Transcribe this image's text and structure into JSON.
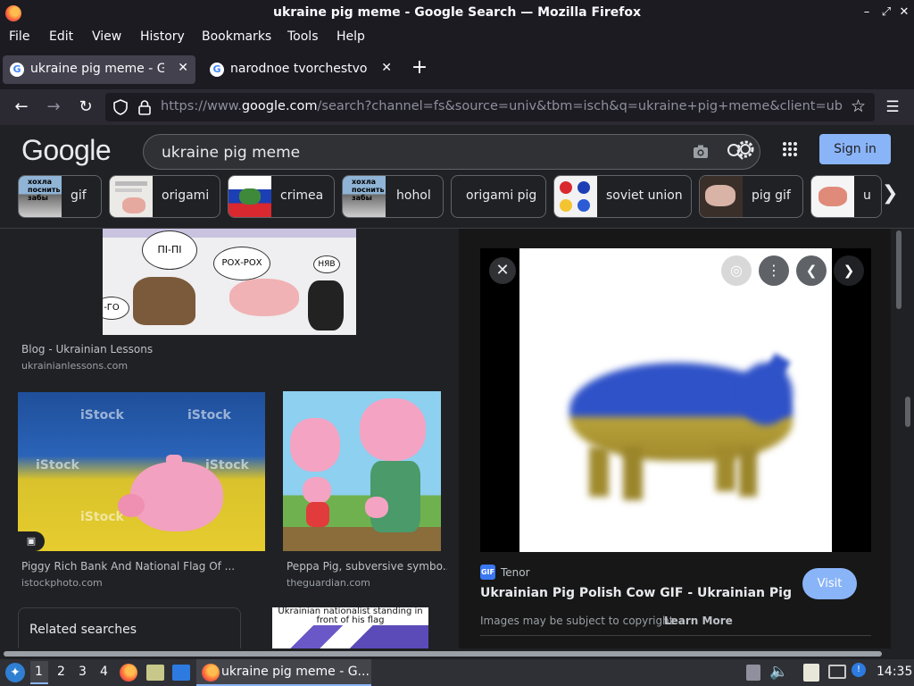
{
  "window": {
    "title": "ukraine pig meme - Google Search — Mozilla Firefox"
  },
  "menu": [
    "File",
    "Edit",
    "View",
    "History",
    "Bookmarks",
    "Tools",
    "Help"
  ],
  "tabs": [
    {
      "label": "ukraine pig meme - Google Search",
      "active": true
    },
    {
      "label": "narodnoe tvorchestvo - Google Search",
      "active": false
    }
  ],
  "urlbar": {
    "prefix": "https://www.",
    "domain": "google.com",
    "path": "/search?channel=fs&source=univ&tbm=isch&q=ukraine+pig+meme&client=ubuntu"
  },
  "google": {
    "logo": "Google",
    "query": "ukraine pig meme",
    "signin": "Sign in",
    "chips": [
      {
        "label": "gif",
        "thumb_text": "хохла поснить забы"
      },
      {
        "label": "origami",
        "thumb_text": ""
      },
      {
        "label": "crimea",
        "thumb_text": ""
      },
      {
        "label": "hohol",
        "thumb_text": "хохла поснить забы"
      },
      {
        "label": "origami pig",
        "thumb_text": ""
      },
      {
        "label": "soviet union",
        "thumb_text": ""
      },
      {
        "label": "pig gif",
        "thumb_text": ""
      },
      {
        "label": "u",
        "thumb_text": ""
      }
    ]
  },
  "results": {
    "comic_bubbles": [
      "ПІ-ПІ",
      "РОХ-РОХ",
      "НЯВ",
      "-ГО"
    ],
    "items": [
      {
        "title": "Blog - Ukrainian Lessons",
        "source": "ukrainianlessons.com"
      },
      {
        "title": "Piggy Rich Bank And National Flag Of ...",
        "source": "istockphoto.com",
        "watermark": "iStock"
      },
      {
        "title": "Peppa Pig, subversive symbo...",
        "source": "theguardian.com"
      }
    ],
    "related": "Related searches",
    "partial_caption": "Ukrainian nationalist standing in front of his flag"
  },
  "preview": {
    "source_badge": "GIF",
    "source": "Tenor",
    "title": "Ukrainian Pig Polish Cow GIF - Ukrainian Pig Pig Po...",
    "visit": "Visit",
    "copyright": "Images may be subject to copyright.",
    "learn_more": "Learn More"
  },
  "taskbar": {
    "workspaces": [
      "1",
      "2",
      "3",
      "4"
    ],
    "active_window": "ukraine pig meme - G...",
    "clock": "14:35"
  },
  "colors": {
    "accent": "#8ab4f8",
    "background": "#202124",
    "ukraine_blue": "#2b5cd6",
    "ukraine_yellow": "#e6c229"
  }
}
